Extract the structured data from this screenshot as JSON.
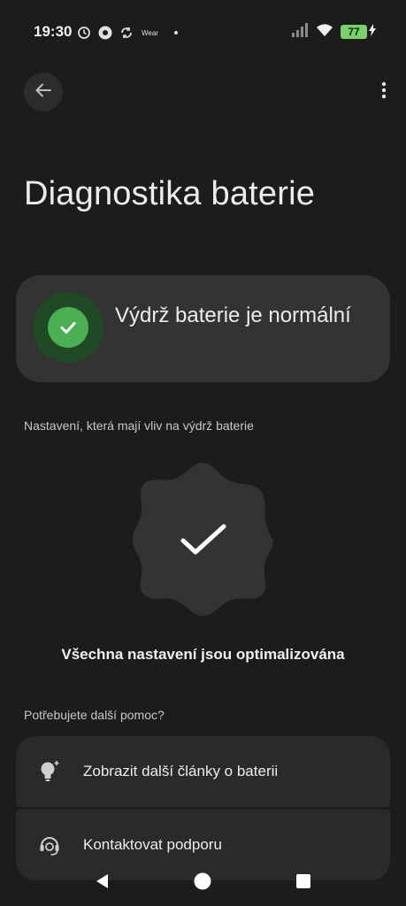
{
  "status_bar": {
    "time": "19:30",
    "wear_label": "Wear",
    "battery_level": "77",
    "icons": [
      "timer-icon",
      "sync-icon",
      "wifi-icon",
      "signal-icon",
      "battery-icon",
      "charging-icon"
    ]
  },
  "header": {
    "back_icon": "arrow-back-icon",
    "more_icon": "more-vert-icon",
    "title": "Diagnostika baterie"
  },
  "status_card": {
    "text": "Výdrž baterie je normální",
    "icon": "check-circle-icon",
    "accent_color": "#4ab053"
  },
  "settings_section": {
    "label": "Nastavení, která mají vliv na výdrž baterie",
    "result_text": "Všechna nastavení jsou optimalizována",
    "icon": "check-icon"
  },
  "help_section": {
    "label": "Potřebujete další pomoc?",
    "items": [
      {
        "label": "Zobrazit další články o baterii",
        "icon": "lightbulb-icon"
      },
      {
        "label": "Kontaktovat podporu",
        "icon": "support-agent-icon"
      }
    ]
  },
  "nav_bar": {
    "icons": [
      "nav-back-icon",
      "nav-home-icon",
      "nav-recents-icon"
    ]
  }
}
